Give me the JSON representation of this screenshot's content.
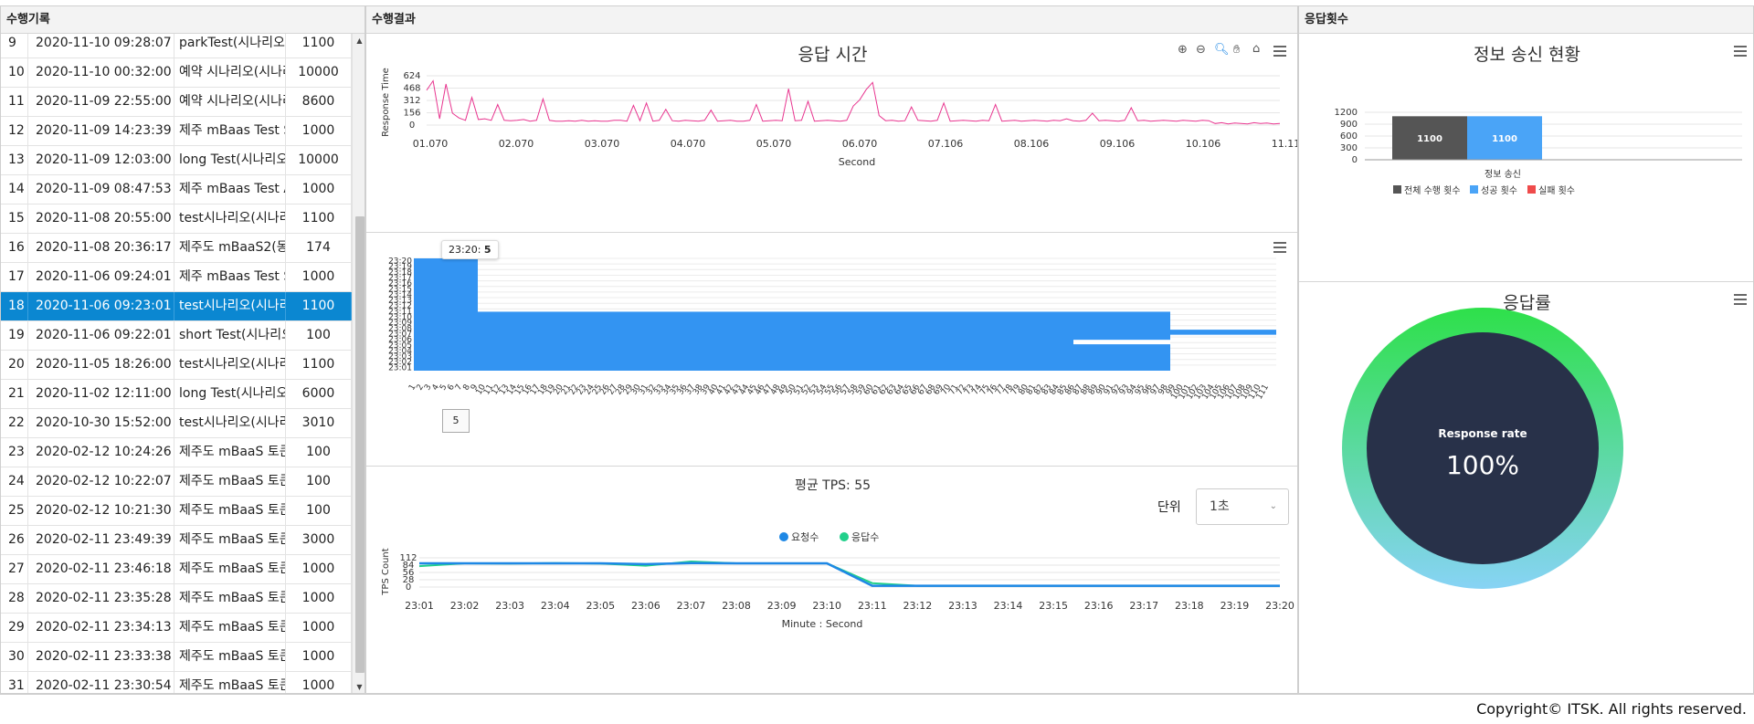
{
  "history": {
    "title": "수행기록",
    "rows": [
      [
        "9",
        "2020-11-10 09:28:07",
        "parkTest(시나리오)",
        "1100"
      ],
      [
        "10",
        "2020-11-10 00:32:00",
        "예약 시나리오(시나리",
        "10000"
      ],
      [
        "11",
        "2020-11-09 22:55:00",
        "예약 시나리오(시나리",
        "8600"
      ],
      [
        "12",
        "2020-11-09 14:23:39",
        "제주 mBaas Test Sc",
        "1000"
      ],
      [
        "13",
        "2020-11-09 12:03:00",
        "long Test(시나리오)",
        "10000"
      ],
      [
        "14",
        "2020-11-09 08:47:53",
        "제주 mBaas Test Ac",
        "1000"
      ],
      [
        "15",
        "2020-11-08 20:55:00",
        "test시나리오(시나리",
        "1100"
      ],
      [
        "16",
        "2020-11-08 20:36:17",
        "제주도 mBaaS2(동:",
        "174"
      ],
      [
        "17",
        "2020-11-06 09:24:01",
        "제주 mBaas Test Sc",
        "1000"
      ],
      [
        "18",
        "2020-11-06 09:23:01",
        "test시나리오(시나리",
        "1100"
      ],
      [
        "19",
        "2020-11-06 09:22:01",
        "short Test(시나리오",
        "100"
      ],
      [
        "20",
        "2020-11-05 18:26:00",
        "test시나리오(시나리",
        "1100"
      ],
      [
        "21",
        "2020-11-02 12:11:00",
        "long Test(시나리오)",
        "6000"
      ],
      [
        "22",
        "2020-10-30 15:52:00",
        "test시나리오(시나리",
        "3010"
      ],
      [
        "23",
        "2020-02-12 10:24:26",
        "제주도 mBaaS 토큰:",
        "100"
      ],
      [
        "24",
        "2020-02-12 10:22:07",
        "제주도 mBaaS 토큰:",
        "100"
      ],
      [
        "25",
        "2020-02-12 10:21:30",
        "제주도 mBaaS 토큰:",
        "100"
      ],
      [
        "26",
        "2020-02-11 23:49:39",
        "제주도 mBaaS 토큰:",
        "3000"
      ],
      [
        "27",
        "2020-02-11 23:46:18",
        "제주도 mBaaS 토큰:",
        "1000"
      ],
      [
        "28",
        "2020-02-11 23:35:28",
        "제주도 mBaaS 토큰:",
        "1000"
      ],
      [
        "29",
        "2020-02-11 23:34:13",
        "제주도 mBaaS 토큰:",
        "1000"
      ],
      [
        "30",
        "2020-02-11 23:33:38",
        "제주도 mBaaS 토큰:",
        "1000"
      ],
      [
        "31",
        "2020-02-11 23:30:54",
        "제주도 mBaaS 토큰:",
        "1000"
      ]
    ],
    "selected_index": 9
  },
  "result": {
    "title": "수행결과",
    "response_title": "응답 시간",
    "tps_avg_label": "평균 TPS: 55",
    "unit_label": "단위",
    "unit_value": "1초",
    "tooltip_label": "23:20:",
    "tooltip_value": "5",
    "cursor_value": "5"
  },
  "count": {
    "title": "응답횟수",
    "send_title": "정보 송신 현황",
    "rate_title": "응답률",
    "rate_label": "Response rate",
    "rate_value": "100%"
  },
  "footer": {
    "copyright": "Copyright© ITSK. All rights reserved."
  },
  "colors": {
    "selected_row": "#0b87d1",
    "response_line": "#e8358f",
    "heat": "#3394f2",
    "total": "#555555",
    "success": "#4aa4f7",
    "fail": "#ef4b4b",
    "request": "#1e88e5",
    "response": "#22d08b",
    "gauge_top": "#2ee04a",
    "gauge_bottom": "#87d3f5",
    "gauge_center": "#283149"
  },
  "chart_data": [
    {
      "type": "line",
      "title": "응답 시간",
      "xlabel": "Second",
      "ylabel": "Response Time",
      "ylim": [
        0,
        624
      ],
      "yticks": [
        "0",
        "156",
        "312",
        "468",
        "624"
      ],
      "xticks": [
        "01.070",
        "02.070",
        "03.070",
        "04.070",
        "05.070",
        "06.070",
        "07.106",
        "08.106",
        "09.106",
        "10.106",
        "11.113"
      ],
      "series": [
        {
          "values": [
            440,
            560,
            80,
            520,
            150,
            90,
            60,
            350,
            70,
            80,
            60,
            260,
            60,
            55,
            60,
            70,
            50,
            60,
            330,
            60,
            50,
            50,
            55,
            50,
            60,
            50,
            55,
            50,
            50,
            60,
            60,
            50,
            250,
            55,
            280,
            50,
            60,
            200,
            55,
            50,
            60,
            55,
            50,
            60,
            190,
            50,
            55,
            60,
            50,
            50,
            60,
            260,
            50,
            55,
            60,
            55,
            460,
            55,
            60,
            300,
            50,
            55,
            60,
            55,
            50,
            60,
            240,
            320,
            450,
            540,
            120,
            55,
            60,
            50,
            55,
            230,
            60,
            55,
            50,
            60,
            280,
            50,
            55,
            60,
            55,
            50,
            60,
            55,
            260,
            50,
            55,
            60,
            50,
            55,
            60,
            55,
            50,
            60,
            55,
            80,
            55,
            50,
            60,
            150,
            55,
            60,
            55,
            50,
            60,
            220,
            55,
            60,
            50,
            55,
            60,
            55,
            50,
            60,
            55,
            50,
            60,
            55,
            20,
            30,
            15,
            25,
            20,
            15,
            30,
            20,
            25,
            15,
            20
          ]
        }
      ]
    },
    {
      "type": "heatmap",
      "categories_x": [
        "1",
        "2",
        "3",
        "…",
        "111"
      ],
      "y_labels": [
        "23:01",
        "23:02",
        "23:03",
        "23:04",
        "23:05",
        "23:06",
        "23:07",
        "23:08",
        "23:09",
        "23:10",
        "23:11",
        "23:12",
        "23:13",
        "23:14",
        "23:15",
        "23:16",
        "23:17",
        "23:18",
        "23:19",
        "23:20"
      ],
      "tooltip": {
        "label": "23:20",
        "value": 5
      }
    },
    {
      "type": "line",
      "title": "평균 TPS: 55",
      "xlabel": "Minute : Second",
      "ylabel": "TPS Count",
      "ylim": [
        0,
        112
      ],
      "yticks": [
        "0",
        "28",
        "56",
        "84",
        "112"
      ],
      "categories": [
        "23:01",
        "23:02",
        "23:03",
        "23:04",
        "23:05",
        "23:06",
        "23:07",
        "23:08",
        "23:09",
        "23:10",
        "23:11",
        "23:12",
        "23:13",
        "23:14",
        "23:15",
        "23:16",
        "23:17",
        "23:18",
        "23:19",
        "23:20"
      ],
      "series": [
        {
          "name": "요청수",
          "values": [
            91,
            91,
            91,
            91,
            91,
            88,
            92,
            91,
            91,
            91,
            5,
            5,
            5,
            5,
            5,
            5,
            5,
            5,
            5,
            5
          ]
        },
        {
          "name": "응답수",
          "values": [
            80,
            91,
            90,
            92,
            90,
            82,
            98,
            91,
            91,
            91,
            15,
            5,
            5,
            5,
            5,
            5,
            5,
            5,
            5,
            5
          ]
        }
      ]
    },
    {
      "type": "bar",
      "title": "정보 송신 현황",
      "xlabel": "정보 송신",
      "ylim": [
        0,
        1200
      ],
      "yticks": [
        "0",
        "300",
        "600",
        "900",
        "1200"
      ],
      "categories": [
        "정보 송신"
      ],
      "series": [
        {
          "name": "전체 수행 횟수",
          "values": [
            1100
          ]
        },
        {
          "name": "성공 횟수",
          "values": [
            1100
          ]
        },
        {
          "name": "실패 횟수",
          "values": [
            0
          ]
        }
      ]
    },
    {
      "type": "pie",
      "title": "응답률",
      "label": "Response rate",
      "value": "100%",
      "values": [
        100
      ]
    }
  ]
}
